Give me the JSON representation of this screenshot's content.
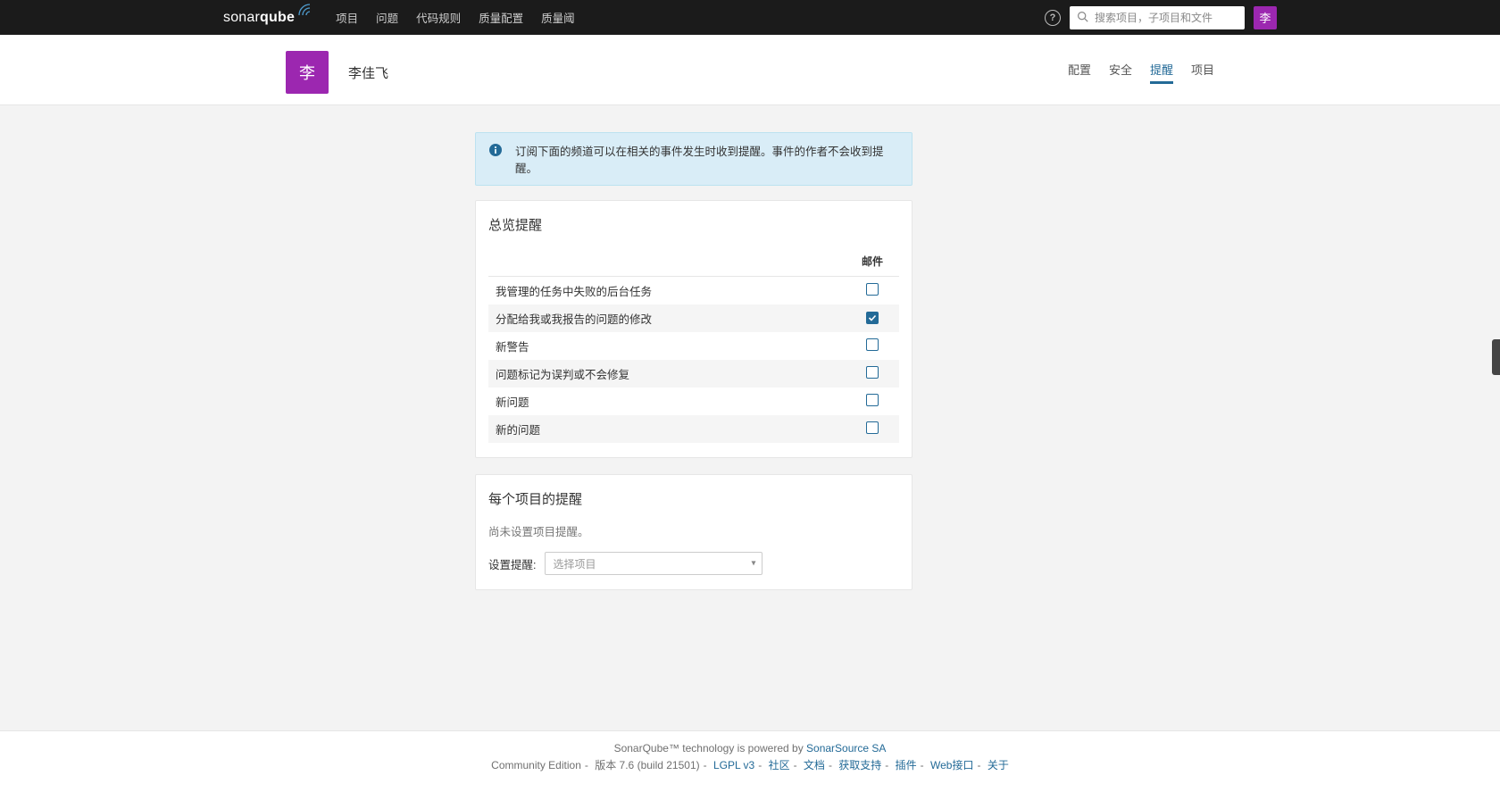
{
  "brand": {
    "thin": "sonar",
    "bold": "qube"
  },
  "nav": {
    "items": [
      "项目",
      "问题",
      "代码规则",
      "质量配置",
      "质量阈"
    ]
  },
  "search": {
    "placeholder": "搜索项目，子项目和文件"
  },
  "user": {
    "initial": "李",
    "name": "李佳飞"
  },
  "subtabs": {
    "items": [
      {
        "label": "配置",
        "active": false
      },
      {
        "label": "安全",
        "active": false
      },
      {
        "label": "提醒",
        "active": true
      },
      {
        "label": "项目",
        "active": false
      }
    ]
  },
  "banner": {
    "text": "订阅下面的频道可以在相关的事件发生时收到提醒。事件的作者不会收到提醒。"
  },
  "panel_global": {
    "title": "总览提醒",
    "col_email": "邮件",
    "rows": [
      {
        "label": "我管理的任务中失败的后台任务",
        "checked": false
      },
      {
        "label": "分配给我或我报告的问题的修改",
        "checked": true
      },
      {
        "label": "新警告",
        "checked": false
      },
      {
        "label": "问题标记为误判或不会修复",
        "checked": false
      },
      {
        "label": "新问题",
        "checked": false
      },
      {
        "label": "新的问题",
        "checked": false
      }
    ]
  },
  "panel_project": {
    "title": "每个项目的提醒",
    "empty": "尚未设置项目提醒。",
    "form_label": "设置提醒:",
    "select_placeholder": "选择项目"
  },
  "footer": {
    "line1_prefix": "SonarQube™ technology is powered by ",
    "line1_link": "SonarSource SA",
    "edition": "Community Edition",
    "version": "版本 7.6 (build 21501)",
    "links": [
      "LGPL v3",
      "社区",
      "文档",
      "获取支持",
      "插件",
      "Web接口",
      "关于"
    ]
  }
}
